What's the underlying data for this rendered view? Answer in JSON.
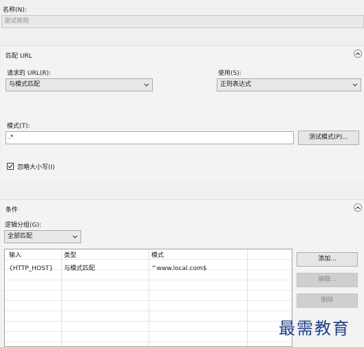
{
  "rule_name": {
    "label": "名称(N):",
    "value": "测试规则"
  },
  "match_url": {
    "title": "匹配 URL",
    "requested_url_label": "请求的 URL(R):",
    "requested_url_value": "与模式匹配",
    "using_label": "使用(S):",
    "using_value": "正则表达式",
    "pattern_label": "模式(T):",
    "pattern_value": ".*",
    "test_pattern_button": "测试模式(P)...",
    "ignore_case_label": "忽略大小写(I)",
    "ignore_case_checked": true
  },
  "conditions": {
    "title": "条件",
    "logical_grouping_label": "逻辑分组(G):",
    "logical_grouping_value": "全部匹配",
    "columns": [
      "输入",
      "类型",
      "模式"
    ],
    "rows": [
      [
        "{HTTP_HOST}",
        "与模式匹配",
        "^www.local.com$"
      ]
    ],
    "add_button": "添加...",
    "edit_button": "编辑...",
    "remove_button": "删除"
  },
  "watermark": "最需教育",
  "icons": {
    "collapse": "chevron-up-circle-icon",
    "dropdown": "chevron-down-icon",
    "checkbox": "checkmark-icon"
  }
}
